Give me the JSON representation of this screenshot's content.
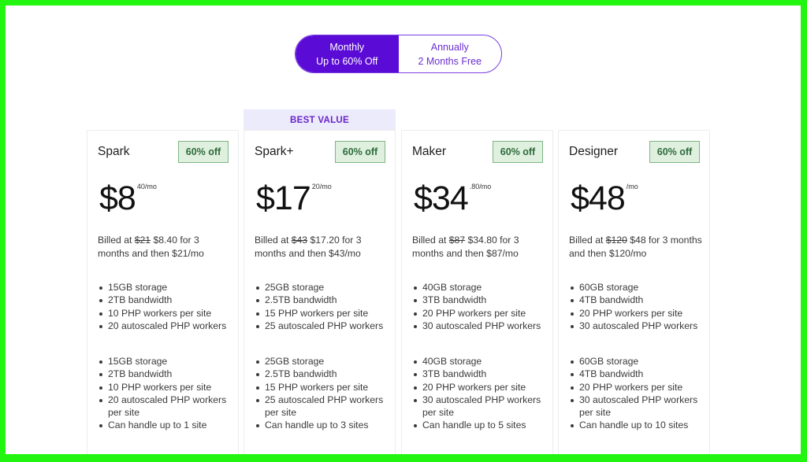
{
  "billing_toggle": {
    "options": [
      {
        "line1": "Monthly",
        "line2": "Up to 60% Off",
        "active": true
      },
      {
        "line1": "Annually",
        "line2": "2 Months Free",
        "active": false
      }
    ]
  },
  "best_value_label": "BEST VALUE",
  "colors": {
    "accent": "#5b0bd6",
    "banner_bg": "#ebebfb",
    "badge_bg": "#dff0df",
    "badge_text": "#2e6a3b",
    "frame": "#22f50f"
  },
  "plans": [
    {
      "name": "Spark",
      "badge": "60% off",
      "price": "$8",
      "price_suffix": "40/mo",
      "billed_prefix": "Billed at ",
      "billed_old": "$21",
      "billed_rest": " $8.40 for 3 months and then $21/mo",
      "features_a": [
        "15GB storage",
        "2TB bandwidth",
        "10 PHP workers per site",
        "20 autoscaled PHP workers"
      ],
      "features_b": [
        "15GB storage",
        "2TB bandwidth",
        "10 PHP workers per site",
        "20 autoscaled PHP workers per site",
        "Can handle up to 1 site"
      ]
    },
    {
      "name": "Spark+",
      "badge": "60% off",
      "price": "$17",
      "price_suffix": "20/mo",
      "billed_prefix": "Billed at ",
      "billed_old": "$43",
      "billed_rest": " $17.20 for 3 months and then $43/mo",
      "features_a": [
        "25GB storage",
        "2.5TB bandwidth",
        "15 PHP workers per site",
        "25 autoscaled PHP workers"
      ],
      "features_b": [
        "25GB storage",
        "2.5TB bandwidth",
        "15 PHP workers per site",
        "25 autoscaled PHP workers per site",
        "Can handle up to 3 sites"
      ]
    },
    {
      "name": "Maker",
      "badge": "60% off",
      "price": "$34",
      "price_suffix": ".80/mo",
      "billed_prefix": "Billed at ",
      "billed_old": "$87",
      "billed_rest": " $34.80 for 3 months and then $87/mo",
      "features_a": [
        "40GB storage",
        "3TB bandwidth",
        "20 PHP workers per site",
        "30 autoscaled PHP workers"
      ],
      "features_b": [
        "40GB storage",
        "3TB bandwidth",
        "20 PHP workers per site",
        "30 autoscaled PHP workers per site",
        "Can handle up to 5 sites"
      ]
    },
    {
      "name": "Designer",
      "badge": "60% off",
      "price": "$48",
      "price_suffix": "/mo",
      "billed_prefix": "Billed at ",
      "billed_old": "$120",
      "billed_rest": " $48 for 3 months and then $120/mo",
      "features_a": [
        "60GB storage",
        "4TB bandwidth",
        "20 PHP workers per site",
        "30 autoscaled PHP workers"
      ],
      "features_b": [
        "60GB storage",
        "4TB bandwidth",
        "20 PHP workers per site",
        "30 autoscaled PHP workers per site",
        "Can handle up to 10 sites"
      ]
    }
  ]
}
